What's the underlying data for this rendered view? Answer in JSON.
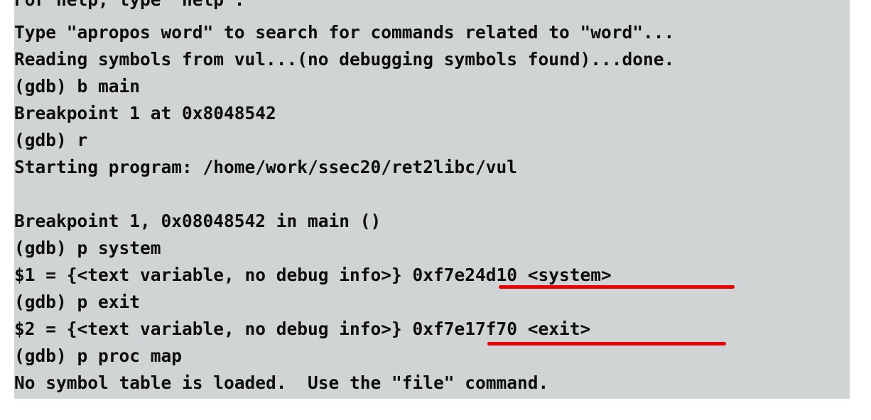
{
  "terminal": {
    "lines": [
      "For help, type \"help\".",
      "Type \"apropos word\" to search for commands related to \"word\"...",
      "Reading symbols from vul...(no debugging symbols found)...done.",
      "(gdb) b main",
      "Breakpoint 1 at 0x8048542",
      "(gdb) r",
      "Starting program: /home/work/ssec20/ret2libc/vul",
      "",
      "Breakpoint 1, 0x08048542 in main ()",
      "(gdb) p system",
      "$1 = {<text variable, no debug info>} 0xf7e24d10 <system>",
      "(gdb) p exit",
      "$2 = {<text variable, no debug info>} 0xf7e17f70 <exit>",
      "(gdb) p proc map",
      "No symbol table is loaded.  Use the \"file\" command."
    ]
  },
  "annotations": {
    "underline_color": "#e80000"
  }
}
